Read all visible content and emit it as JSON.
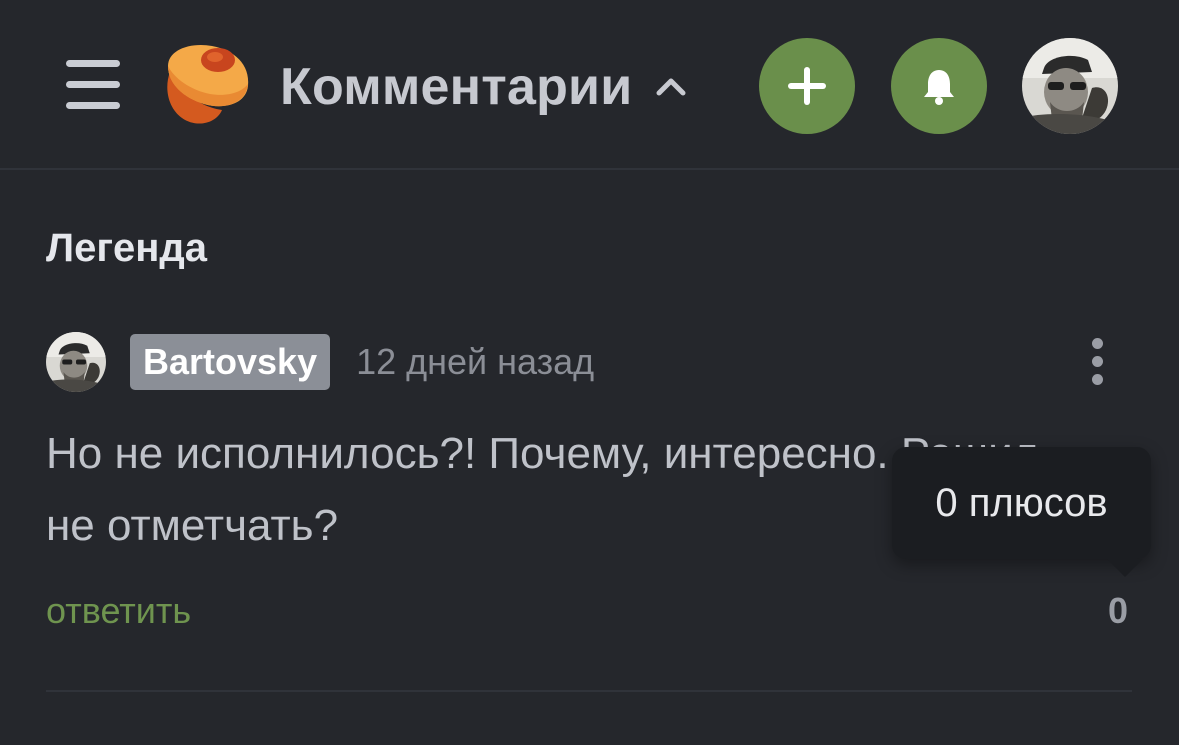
{
  "header": {
    "title": "Комментарии",
    "menu_icon": "hamburger-menu-icon",
    "logo_icon": "pikabu-logo-icon",
    "caret_icon": "chevron-up-icon",
    "add_icon": "plus-icon",
    "bell_icon": "bell-icon",
    "accent_color": "#6a8f4b"
  },
  "section": {
    "title": "Легенда"
  },
  "comment": {
    "username": "Bartovsky",
    "time": "12 дней назад",
    "text": "Но не исполнилось?! Почему, интересно. Решил\nне отметчать?",
    "reply_label": "ответить",
    "rating": "0",
    "reply_color": "#6f944f"
  },
  "tooltip": {
    "text": "0 плюсов"
  }
}
